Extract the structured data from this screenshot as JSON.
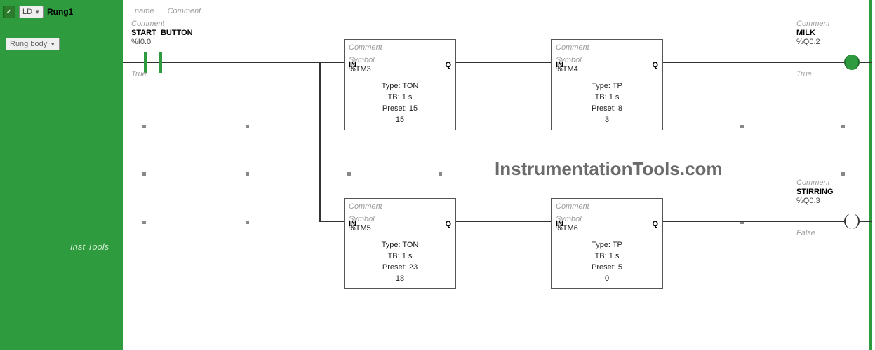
{
  "sidebar": {
    "ld_selector": "LD",
    "rung_title": "Rung1",
    "rung_body": "Rung body",
    "inst_tools": "Inst Tools"
  },
  "header": {
    "name_hint": "name",
    "comment_hint": "Comment"
  },
  "contact": {
    "comment": "Comment",
    "name": "START_BUTTON",
    "address": "%I0.0",
    "state": "True"
  },
  "coil1": {
    "comment": "Comment",
    "name": "MILK",
    "address": "%Q0.2",
    "state": "True"
  },
  "coil2": {
    "comment": "Comment",
    "name": "STIRRING",
    "address": "%Q0.3",
    "state": "False"
  },
  "timers": {
    "tm3": {
      "comment": "Comment",
      "symbol_hint": "Symbol",
      "address": "%TM3",
      "type": "Type: TON",
      "tb": "TB: 1 s",
      "preset": "Preset: 15",
      "current": "15",
      "in": "IN",
      "q": "Q"
    },
    "tm4": {
      "comment": "Comment",
      "symbol_hint": "Symbol",
      "address": "%TM4",
      "type": "Type: TP",
      "tb": "TB: 1 s",
      "preset": "Preset: 8",
      "current": "3",
      "in": "IN",
      "q": "Q"
    },
    "tm5": {
      "comment": "Comment",
      "symbol_hint": "Symbol",
      "address": "%TM5",
      "type": "Type: TON",
      "tb": "TB: 1 s",
      "preset": "Preset: 23",
      "current": "18",
      "in": "IN",
      "q": "Q"
    },
    "tm6": {
      "comment": "Comment",
      "symbol_hint": "Symbol",
      "address": "%TM6",
      "type": "Type: TP",
      "tb": "TB: 1 s",
      "preset": "Preset: 5",
      "current": "0",
      "in": "IN",
      "q": "Q"
    }
  },
  "watermark": "InstrumentationTools.com",
  "icons": {
    "check": "✓",
    "triangle_down": "▼"
  }
}
